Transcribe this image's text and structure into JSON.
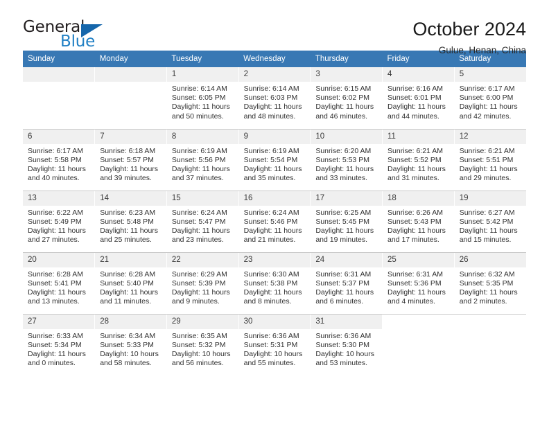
{
  "brand": {
    "name_part1": "General",
    "name_part2": "Blue",
    "triangle_color": "#1566ab",
    "blue_color": "#1f7fc4"
  },
  "header": {
    "title": "October 2024",
    "location": "Gulue, Henan, China"
  },
  "calendar": {
    "header_bg": "#3878b4",
    "daynum_bg": "#f0f0f0",
    "weekdays": [
      "Sunday",
      "Monday",
      "Tuesday",
      "Wednesday",
      "Thursday",
      "Friday",
      "Saturday"
    ],
    "labels": {
      "sunrise": "Sunrise:",
      "sunset": "Sunset:",
      "daylight": "Daylight:"
    },
    "weeks": [
      [
        {
          "day": "",
          "empty": true
        },
        {
          "day": "",
          "empty": true
        },
        {
          "day": "1",
          "sunrise": "Sunrise: 6:14 AM",
          "sunset": "Sunset: 6:05 PM",
          "daylight_line1": "Daylight: 11 hours",
          "daylight_line2": "and 50 minutes."
        },
        {
          "day": "2",
          "sunrise": "Sunrise: 6:14 AM",
          "sunset": "Sunset: 6:03 PM",
          "daylight_line1": "Daylight: 11 hours",
          "daylight_line2": "and 48 minutes."
        },
        {
          "day": "3",
          "sunrise": "Sunrise: 6:15 AM",
          "sunset": "Sunset: 6:02 PM",
          "daylight_line1": "Daylight: 11 hours",
          "daylight_line2": "and 46 minutes."
        },
        {
          "day": "4",
          "sunrise": "Sunrise: 6:16 AM",
          "sunset": "Sunset: 6:01 PM",
          "daylight_line1": "Daylight: 11 hours",
          "daylight_line2": "and 44 minutes."
        },
        {
          "day": "5",
          "sunrise": "Sunrise: 6:17 AM",
          "sunset": "Sunset: 6:00 PM",
          "daylight_line1": "Daylight: 11 hours",
          "daylight_line2": "and 42 minutes."
        }
      ],
      [
        {
          "day": "6",
          "sunrise": "Sunrise: 6:17 AM",
          "sunset": "Sunset: 5:58 PM",
          "daylight_line1": "Daylight: 11 hours",
          "daylight_line2": "and 40 minutes."
        },
        {
          "day": "7",
          "sunrise": "Sunrise: 6:18 AM",
          "sunset": "Sunset: 5:57 PM",
          "daylight_line1": "Daylight: 11 hours",
          "daylight_line2": "and 39 minutes."
        },
        {
          "day": "8",
          "sunrise": "Sunrise: 6:19 AM",
          "sunset": "Sunset: 5:56 PM",
          "daylight_line1": "Daylight: 11 hours",
          "daylight_line2": "and 37 minutes."
        },
        {
          "day": "9",
          "sunrise": "Sunrise: 6:19 AM",
          "sunset": "Sunset: 5:54 PM",
          "daylight_line1": "Daylight: 11 hours",
          "daylight_line2": "and 35 minutes."
        },
        {
          "day": "10",
          "sunrise": "Sunrise: 6:20 AM",
          "sunset": "Sunset: 5:53 PM",
          "daylight_line1": "Daylight: 11 hours",
          "daylight_line2": "and 33 minutes."
        },
        {
          "day": "11",
          "sunrise": "Sunrise: 6:21 AM",
          "sunset": "Sunset: 5:52 PM",
          "daylight_line1": "Daylight: 11 hours",
          "daylight_line2": "and 31 minutes."
        },
        {
          "day": "12",
          "sunrise": "Sunrise: 6:21 AM",
          "sunset": "Sunset: 5:51 PM",
          "daylight_line1": "Daylight: 11 hours",
          "daylight_line2": "and 29 minutes."
        }
      ],
      [
        {
          "day": "13",
          "sunrise": "Sunrise: 6:22 AM",
          "sunset": "Sunset: 5:49 PM",
          "daylight_line1": "Daylight: 11 hours",
          "daylight_line2": "and 27 minutes."
        },
        {
          "day": "14",
          "sunrise": "Sunrise: 6:23 AM",
          "sunset": "Sunset: 5:48 PM",
          "daylight_line1": "Daylight: 11 hours",
          "daylight_line2": "and 25 minutes."
        },
        {
          "day": "15",
          "sunrise": "Sunrise: 6:24 AM",
          "sunset": "Sunset: 5:47 PM",
          "daylight_line1": "Daylight: 11 hours",
          "daylight_line2": "and 23 minutes."
        },
        {
          "day": "16",
          "sunrise": "Sunrise: 6:24 AM",
          "sunset": "Sunset: 5:46 PM",
          "daylight_line1": "Daylight: 11 hours",
          "daylight_line2": "and 21 minutes."
        },
        {
          "day": "17",
          "sunrise": "Sunrise: 6:25 AM",
          "sunset": "Sunset: 5:45 PM",
          "daylight_line1": "Daylight: 11 hours",
          "daylight_line2": "and 19 minutes."
        },
        {
          "day": "18",
          "sunrise": "Sunrise: 6:26 AM",
          "sunset": "Sunset: 5:43 PM",
          "daylight_line1": "Daylight: 11 hours",
          "daylight_line2": "and 17 minutes."
        },
        {
          "day": "19",
          "sunrise": "Sunrise: 6:27 AM",
          "sunset": "Sunset: 5:42 PM",
          "daylight_line1": "Daylight: 11 hours",
          "daylight_line2": "and 15 minutes."
        }
      ],
      [
        {
          "day": "20",
          "sunrise": "Sunrise: 6:28 AM",
          "sunset": "Sunset: 5:41 PM",
          "daylight_line1": "Daylight: 11 hours",
          "daylight_line2": "and 13 minutes."
        },
        {
          "day": "21",
          "sunrise": "Sunrise: 6:28 AM",
          "sunset": "Sunset: 5:40 PM",
          "daylight_line1": "Daylight: 11 hours",
          "daylight_line2": "and 11 minutes."
        },
        {
          "day": "22",
          "sunrise": "Sunrise: 6:29 AM",
          "sunset": "Sunset: 5:39 PM",
          "daylight_line1": "Daylight: 11 hours",
          "daylight_line2": "and 9 minutes."
        },
        {
          "day": "23",
          "sunrise": "Sunrise: 6:30 AM",
          "sunset": "Sunset: 5:38 PM",
          "daylight_line1": "Daylight: 11 hours",
          "daylight_line2": "and 8 minutes."
        },
        {
          "day": "24",
          "sunrise": "Sunrise: 6:31 AM",
          "sunset": "Sunset: 5:37 PM",
          "daylight_line1": "Daylight: 11 hours",
          "daylight_line2": "and 6 minutes."
        },
        {
          "day": "25",
          "sunrise": "Sunrise: 6:31 AM",
          "sunset": "Sunset: 5:36 PM",
          "daylight_line1": "Daylight: 11 hours",
          "daylight_line2": "and 4 minutes."
        },
        {
          "day": "26",
          "sunrise": "Sunrise: 6:32 AM",
          "sunset": "Sunset: 5:35 PM",
          "daylight_line1": "Daylight: 11 hours",
          "daylight_line2": "and 2 minutes."
        }
      ],
      [
        {
          "day": "27",
          "sunrise": "Sunrise: 6:33 AM",
          "sunset": "Sunset: 5:34 PM",
          "daylight_line1": "Daylight: 11 hours",
          "daylight_line2": "and 0 minutes."
        },
        {
          "day": "28",
          "sunrise": "Sunrise: 6:34 AM",
          "sunset": "Sunset: 5:33 PM",
          "daylight_line1": "Daylight: 10 hours",
          "daylight_line2": "and 58 minutes."
        },
        {
          "day": "29",
          "sunrise": "Sunrise: 6:35 AM",
          "sunset": "Sunset: 5:32 PM",
          "daylight_line1": "Daylight: 10 hours",
          "daylight_line2": "and 56 minutes."
        },
        {
          "day": "30",
          "sunrise": "Sunrise: 6:36 AM",
          "sunset": "Sunset: 5:31 PM",
          "daylight_line1": "Daylight: 10 hours",
          "daylight_line2": "and 55 minutes."
        },
        {
          "day": "31",
          "sunrise": "Sunrise: 6:36 AM",
          "sunset": "Sunset: 5:30 PM",
          "daylight_line1": "Daylight: 10 hours",
          "daylight_line2": "and 53 minutes."
        },
        {
          "day": "",
          "blank": true
        },
        {
          "day": "",
          "blank": true
        }
      ]
    ]
  }
}
